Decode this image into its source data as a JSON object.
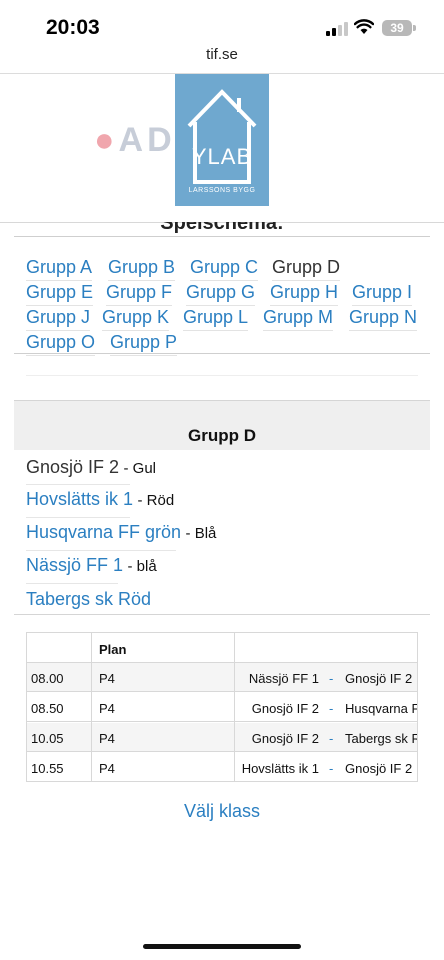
{
  "status_bar": {
    "time": "20:03",
    "battery": "39"
  },
  "browser": {
    "url": "tif.se"
  },
  "banner": {
    "sponsor_left": "ADRIA",
    "logo_title": "YLAB",
    "logo_subtitle": "LARSSONS BYGG"
  },
  "group_nav": {
    "heading": "Spelschema:",
    "groups": [
      {
        "label": "Grupp A",
        "current": false
      },
      {
        "label": "Grupp B",
        "current": false
      },
      {
        "label": "Grupp C",
        "current": false
      },
      {
        "label": "Grupp D",
        "current": true
      },
      {
        "label": "Grupp E",
        "current": false
      },
      {
        "label": "Grupp F",
        "current": false
      },
      {
        "label": "Grupp G",
        "current": false
      },
      {
        "label": "Grupp H",
        "current": false
      },
      {
        "label": "Grupp I",
        "current": false
      },
      {
        "label": "Grupp J",
        "current": false
      },
      {
        "label": "Grupp K",
        "current": false
      },
      {
        "label": "Grupp L",
        "current": false
      },
      {
        "label": "Grupp M",
        "current": false
      },
      {
        "label": "Grupp N",
        "current": false
      },
      {
        "label": "Grupp O",
        "current": false
      },
      {
        "label": "Grupp P",
        "current": false
      }
    ]
  },
  "group": {
    "title": "Grupp D",
    "teams": [
      {
        "name": "Gnosjö IF 2",
        "color": "Gul",
        "linked": false
      },
      {
        "name": "Hovslätts ik 1",
        "color": "Röd",
        "linked": true
      },
      {
        "name": "Husqvarna FF grön",
        "color": "Blå",
        "linked": true
      },
      {
        "name": "Nässjö FF 1",
        "color": "blå",
        "linked": true
      },
      {
        "name": "Tabergs sk Röd",
        "color": "",
        "linked": true
      }
    ]
  },
  "schedule": {
    "headers": {
      "time": "",
      "plan": "Plan",
      "match": ""
    },
    "separator": "-",
    "rows": [
      {
        "time": "08.00",
        "plan": "P4",
        "home": "Nässjö FF 1",
        "away": "Gnosjö IF 2"
      },
      {
        "time": "08.50",
        "plan": "P4",
        "home": "Gnosjö IF 2",
        "away": "Husqvarna FF grön"
      },
      {
        "time": "10.05",
        "plan": "P4",
        "home": "Gnosjö IF 2",
        "away": "Tabergs sk Röd"
      },
      {
        "time": "10.55",
        "plan": "P4",
        "home": "Hovslätts ik 1",
        "away": "Gnosjö IF 2"
      }
    ]
  },
  "footer": {
    "select_class": "Välj klass"
  }
}
